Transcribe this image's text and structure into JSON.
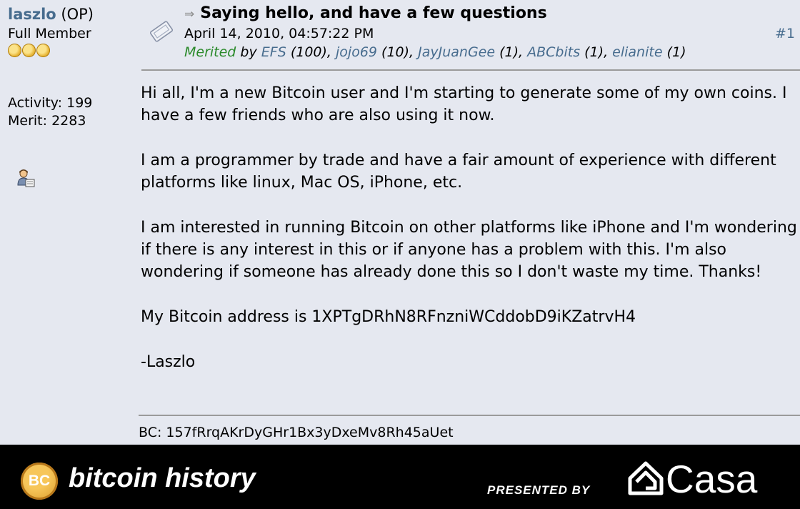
{
  "poster": {
    "name": "laszlo",
    "op_tag": "(OP)",
    "rank": "Full Member",
    "activity": "Activity: 199",
    "merit": "Merit: 2283"
  },
  "post": {
    "arrow": "⇒",
    "subject": "Saying hello, and have a few questions",
    "date": "April 14, 2010, 04:57:22 PM",
    "number": "#1",
    "merit_label": "Merited",
    "merit_by": "by",
    "merits": [
      {
        "user": "EFS",
        "count": "(100),"
      },
      {
        "user": "jojo69",
        "count": "(10),"
      },
      {
        "user": "JayJuanGee",
        "count": "(1),"
      },
      {
        "user": "ABCbits",
        "count": "(1),"
      },
      {
        "user": "elianite",
        "count": "(1)"
      }
    ],
    "body": [
      "Hi all, I'm a new Bitcoin user and I'm starting to generate some of my own coins.  I have a few friends who are also using it now.",
      "I am a programmer by trade and have a fair amount of experience with different platforms like linux, Mac OS, iPhone, etc.",
      "I am interested in running Bitcoin on other platforms like iPhone and I'm wondering if there is any interest in this or if anyone has a problem with this.  I'm also wondering if someone has already done this so I don't waste my time.  Thanks!",
      "My Bitcoin address is 1XPTgDRhN8RFnzniWCddobD9iKZatrvH4",
      "-Laszlo"
    ],
    "signature": "BC: 157fRrqAKrDyGHr1Bx3yDxeMv8Rh45aUet"
  },
  "footer": {
    "logo_letters": "BC",
    "brand": "bitcoin history",
    "presented_by": "PRESENTED BY",
    "sponsor": "Casa"
  },
  "colors": {
    "link": "#476c8e",
    "merited": "#2a8a2a",
    "background": "#e5e8f0",
    "footer": "#000000"
  }
}
